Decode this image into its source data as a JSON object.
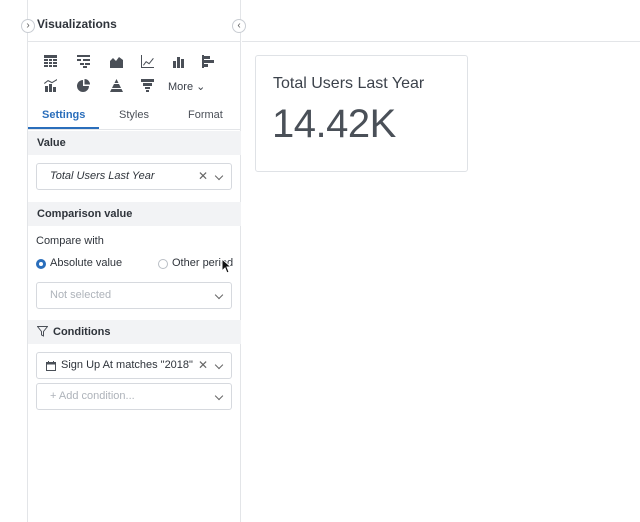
{
  "panel": {
    "title": "Visualizations",
    "viz_icons": [
      "table-icon",
      "pivot-icon",
      "area-chart-icon",
      "line-chart-icon",
      "bar-chart-icon",
      "horizontal-bar-icon",
      "combo-chart-icon",
      "pie-chart-icon",
      "pyramid-icon",
      "funnel-icon"
    ],
    "more_label": "More ⌄"
  },
  "tabs": [
    {
      "label": "Settings",
      "active": true
    },
    {
      "label": "Styles",
      "active": false
    },
    {
      "label": "Format",
      "active": false
    }
  ],
  "value_section": {
    "title": "Value",
    "selected": "Total Users Last Year"
  },
  "comparison_section": {
    "title": "Comparison value",
    "compare_with_label": "Compare with",
    "options": [
      {
        "label": "Absolute value",
        "checked": true
      },
      {
        "label": "Other period",
        "checked": false
      }
    ],
    "select_placeholder": "Not selected"
  },
  "conditions_section": {
    "title": "Conditions",
    "condition": "Sign Up At matches \"2018\"",
    "add_placeholder": "+ Add condition..."
  },
  "kpi": {
    "title": "Total Users Last Year",
    "value": "14.42K"
  },
  "colors": {
    "accent": "#2a6ebb",
    "section_bg": "#f2f3f5",
    "border": "#e3e5e8"
  }
}
